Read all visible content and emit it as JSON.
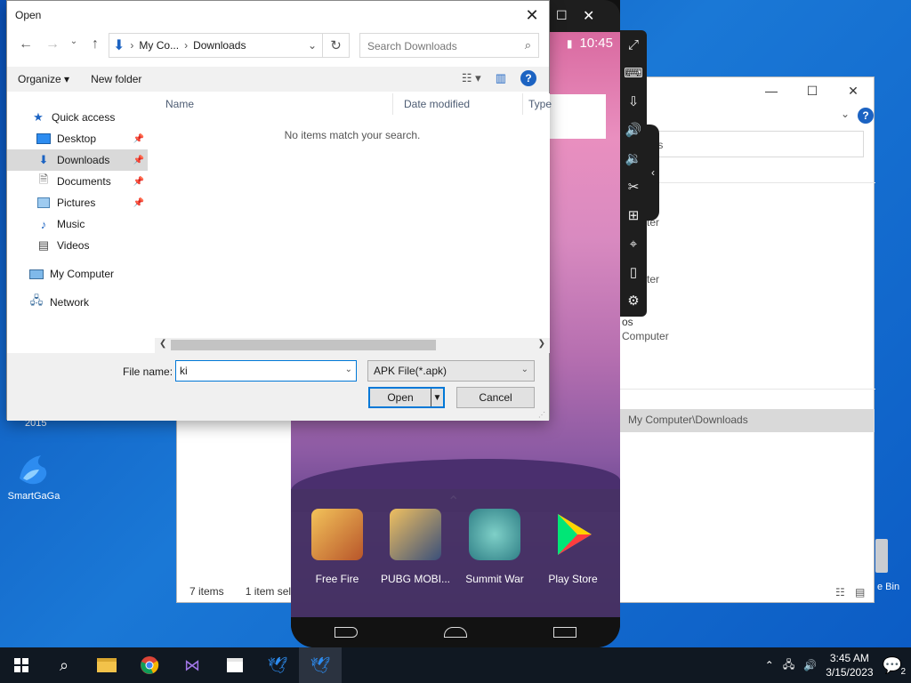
{
  "desktop": {
    "icon_smartgaga": "SmartGaGa",
    "partial_2015": "2015",
    "partial_bin": "e Bin"
  },
  "bg_explorer": {
    "address": "access",
    "row1": "ter",
    "row2": "ter",
    "row3a": "os",
    "row3b": "Computer",
    "selected_path": "My Computer\\Downloads",
    "status_items": "7 items",
    "status_selected": "1 item sele"
  },
  "emulator": {
    "time": "10:45",
    "apps": [
      {
        "label": "Free Fire"
      },
      {
        "label": "PUBG MOBI..."
      },
      {
        "label": "Summit War"
      },
      {
        "label": "Play Store"
      }
    ]
  },
  "dialog": {
    "title": "Open",
    "breadcrumb": [
      "My Co...",
      "Downloads"
    ],
    "search_placeholder": "Search Downloads",
    "organize": "Organize",
    "new_folder": "New folder",
    "nav": [
      {
        "label": "Quick access"
      },
      {
        "label": "Desktop"
      },
      {
        "label": "Downloads"
      },
      {
        "label": "Documents"
      },
      {
        "label": "Pictures"
      },
      {
        "label": "Music"
      },
      {
        "label": "Videos"
      },
      {
        "label": "My Computer"
      },
      {
        "label": "Network"
      }
    ],
    "columns": [
      "Name",
      "Date modified",
      "Type"
    ],
    "empty_message": "No items match your search.",
    "file_name_label": "File name:",
    "file_name_value": "ki",
    "file_type": "APK File(*.apk)",
    "open_button": "Open",
    "cancel_button": "Cancel"
  },
  "taskbar": {
    "time": "3:45 AM",
    "date": "3/15/2023",
    "notifications": "2"
  }
}
